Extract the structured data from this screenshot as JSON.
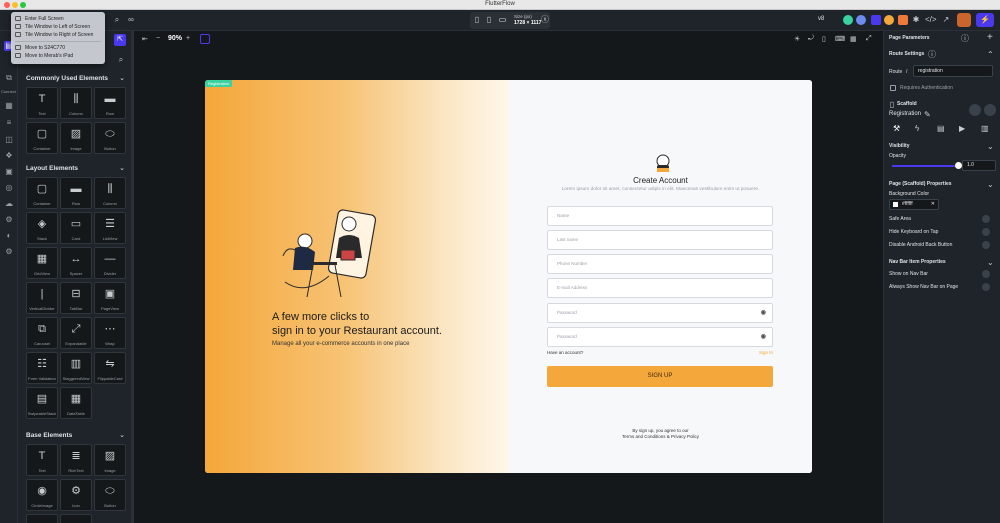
{
  "window": {
    "title": "FlutterFlow"
  },
  "window_menu": {
    "items": [
      {
        "label": "Enter Full Screen"
      },
      {
        "label": "Tile Window to Left of Screen"
      },
      {
        "label": "Tile Window to Right of Screen"
      },
      {
        "label": "Move to S24C770"
      },
      {
        "label": "Move to Merab's iPad"
      }
    ]
  },
  "device": {
    "name": "Size (px)",
    "size": "1728 × 1117"
  },
  "topbar": {
    "version_badge": "v8"
  },
  "zoom": {
    "value": "90%"
  },
  "rail": {
    "connect_label": "Connect"
  },
  "widgets": {
    "common_title": "Commonly Used Elements",
    "common": [
      "Text",
      "Column",
      "Row",
      "Container",
      "Image",
      "Button"
    ],
    "layout_title": "Layout Elements",
    "layout": [
      "Container",
      "Row",
      "Column",
      "Stack",
      "Card",
      "ListView",
      "GridView",
      "Spacer",
      "Divider",
      "VerticalDivider",
      "TabBar",
      "PageView",
      "Carousel",
      "Expandable",
      "Wrap",
      "Form Validation",
      "StaggeredView",
      "FlippableCard",
      "SwipeableStack",
      "DataTable"
    ],
    "base_title": "Base Elements",
    "base": [
      "Text",
      "RichText",
      "Image",
      "CircleImage",
      "Icon",
      "Button"
    ]
  },
  "page": {
    "tag": "Registration",
    "headline_1": "A few more clicks to",
    "headline_2": "sign in to your Restaurant account.",
    "subline": "Manage all your e-commerce accounts in one place",
    "form_title": "Create Account",
    "form_subtitle": "Lorem ipsum dolor sit amet, consectetur adipis in elit. Maecenas vestibulum enim ut posuere.",
    "fields": [
      "Name",
      "Last name",
      "Phone Number",
      "E-mail Address",
      "Password",
      "Password"
    ],
    "have_account": "Have an account?",
    "sign_in": "Sign In",
    "signup_button": "SIGN UP",
    "terms_1": "By sign up, you agree to our",
    "terms_2": "Terms and Conditions & Privacy Policy"
  },
  "props": {
    "page_params": "Page Parameters",
    "route_settings": "Route Settings",
    "route_label": "Route",
    "route_sep": "/",
    "route_value": "registration",
    "requires_auth": "Requires Authentication",
    "scaffold": "Scaffold",
    "page_name": "Registration",
    "visibility": "Visibility",
    "opacity_label": "Opacity",
    "opacity_value": "1.0",
    "opacity": 1.0,
    "scaffold_props": "Page (Scaffold) Properties",
    "bg_color_label": "Background Color",
    "bg_color_value": "#ffffff",
    "safe_area": "Safe Area",
    "hide_keyboard": "Hide Keyboard on Tap",
    "disable_back": "Disable Android Back Button",
    "nav_props": "Nav Bar Item Properties",
    "show_nav": "Show on Nav Bar",
    "always_show_nav": "Always Show Nav Bar on Page"
  },
  "colors": {
    "accent": "#f4a73a",
    "brand": "#4b39ef",
    "canvas_bg": "#14181b",
    "panel_bg": "#1e2429"
  }
}
